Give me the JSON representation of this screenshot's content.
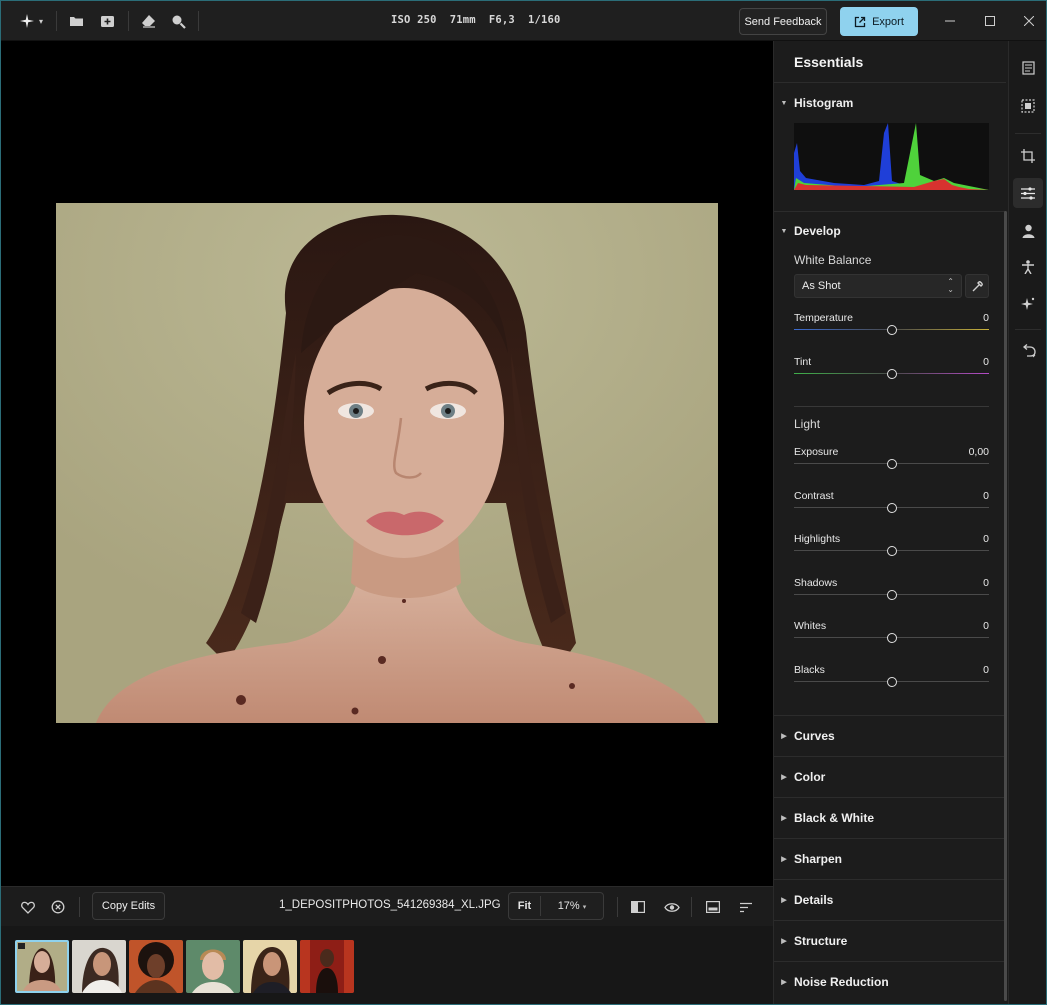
{
  "titlebar": {
    "exif": "ISO 250  71mm  F6,3  1/160",
    "feedback_label": "Send Feedback",
    "export_label": "Export"
  },
  "bottombar": {
    "copy_edits_label": "Copy Edits",
    "filename": "1_DEPOSITPHOTOS_541269384_XL.JPG",
    "fit_label": "Fit",
    "zoom_value": "17%"
  },
  "panel": {
    "title": "Essentials",
    "histogram_label": "Histogram",
    "develop_label": "Develop",
    "white_balance_label": "White Balance",
    "white_balance_value": "As Shot",
    "light_label": "Light",
    "wb_sliders": [
      {
        "label": "Temperature",
        "value": "0"
      },
      {
        "label": "Tint",
        "value": "0"
      }
    ],
    "light_sliders": [
      {
        "label": "Exposure",
        "value": "0,00"
      },
      {
        "label": "Contrast",
        "value": "0"
      },
      {
        "label": "Highlights",
        "value": "0"
      },
      {
        "label": "Shadows",
        "value": "0"
      },
      {
        "label": "Whites",
        "value": "0"
      },
      {
        "label": "Blacks",
        "value": "0"
      }
    ],
    "collapsed_sections": [
      "Curves",
      "Color",
      "Black & White",
      "Sharpen",
      "Details",
      "Structure",
      "Noise Reduction"
    ]
  },
  "colors": {
    "accent": "#8fd2ee",
    "histogram_blue": "#1f3fd8",
    "histogram_green": "#4fd23b",
    "histogram_red": "#d8322f"
  }
}
